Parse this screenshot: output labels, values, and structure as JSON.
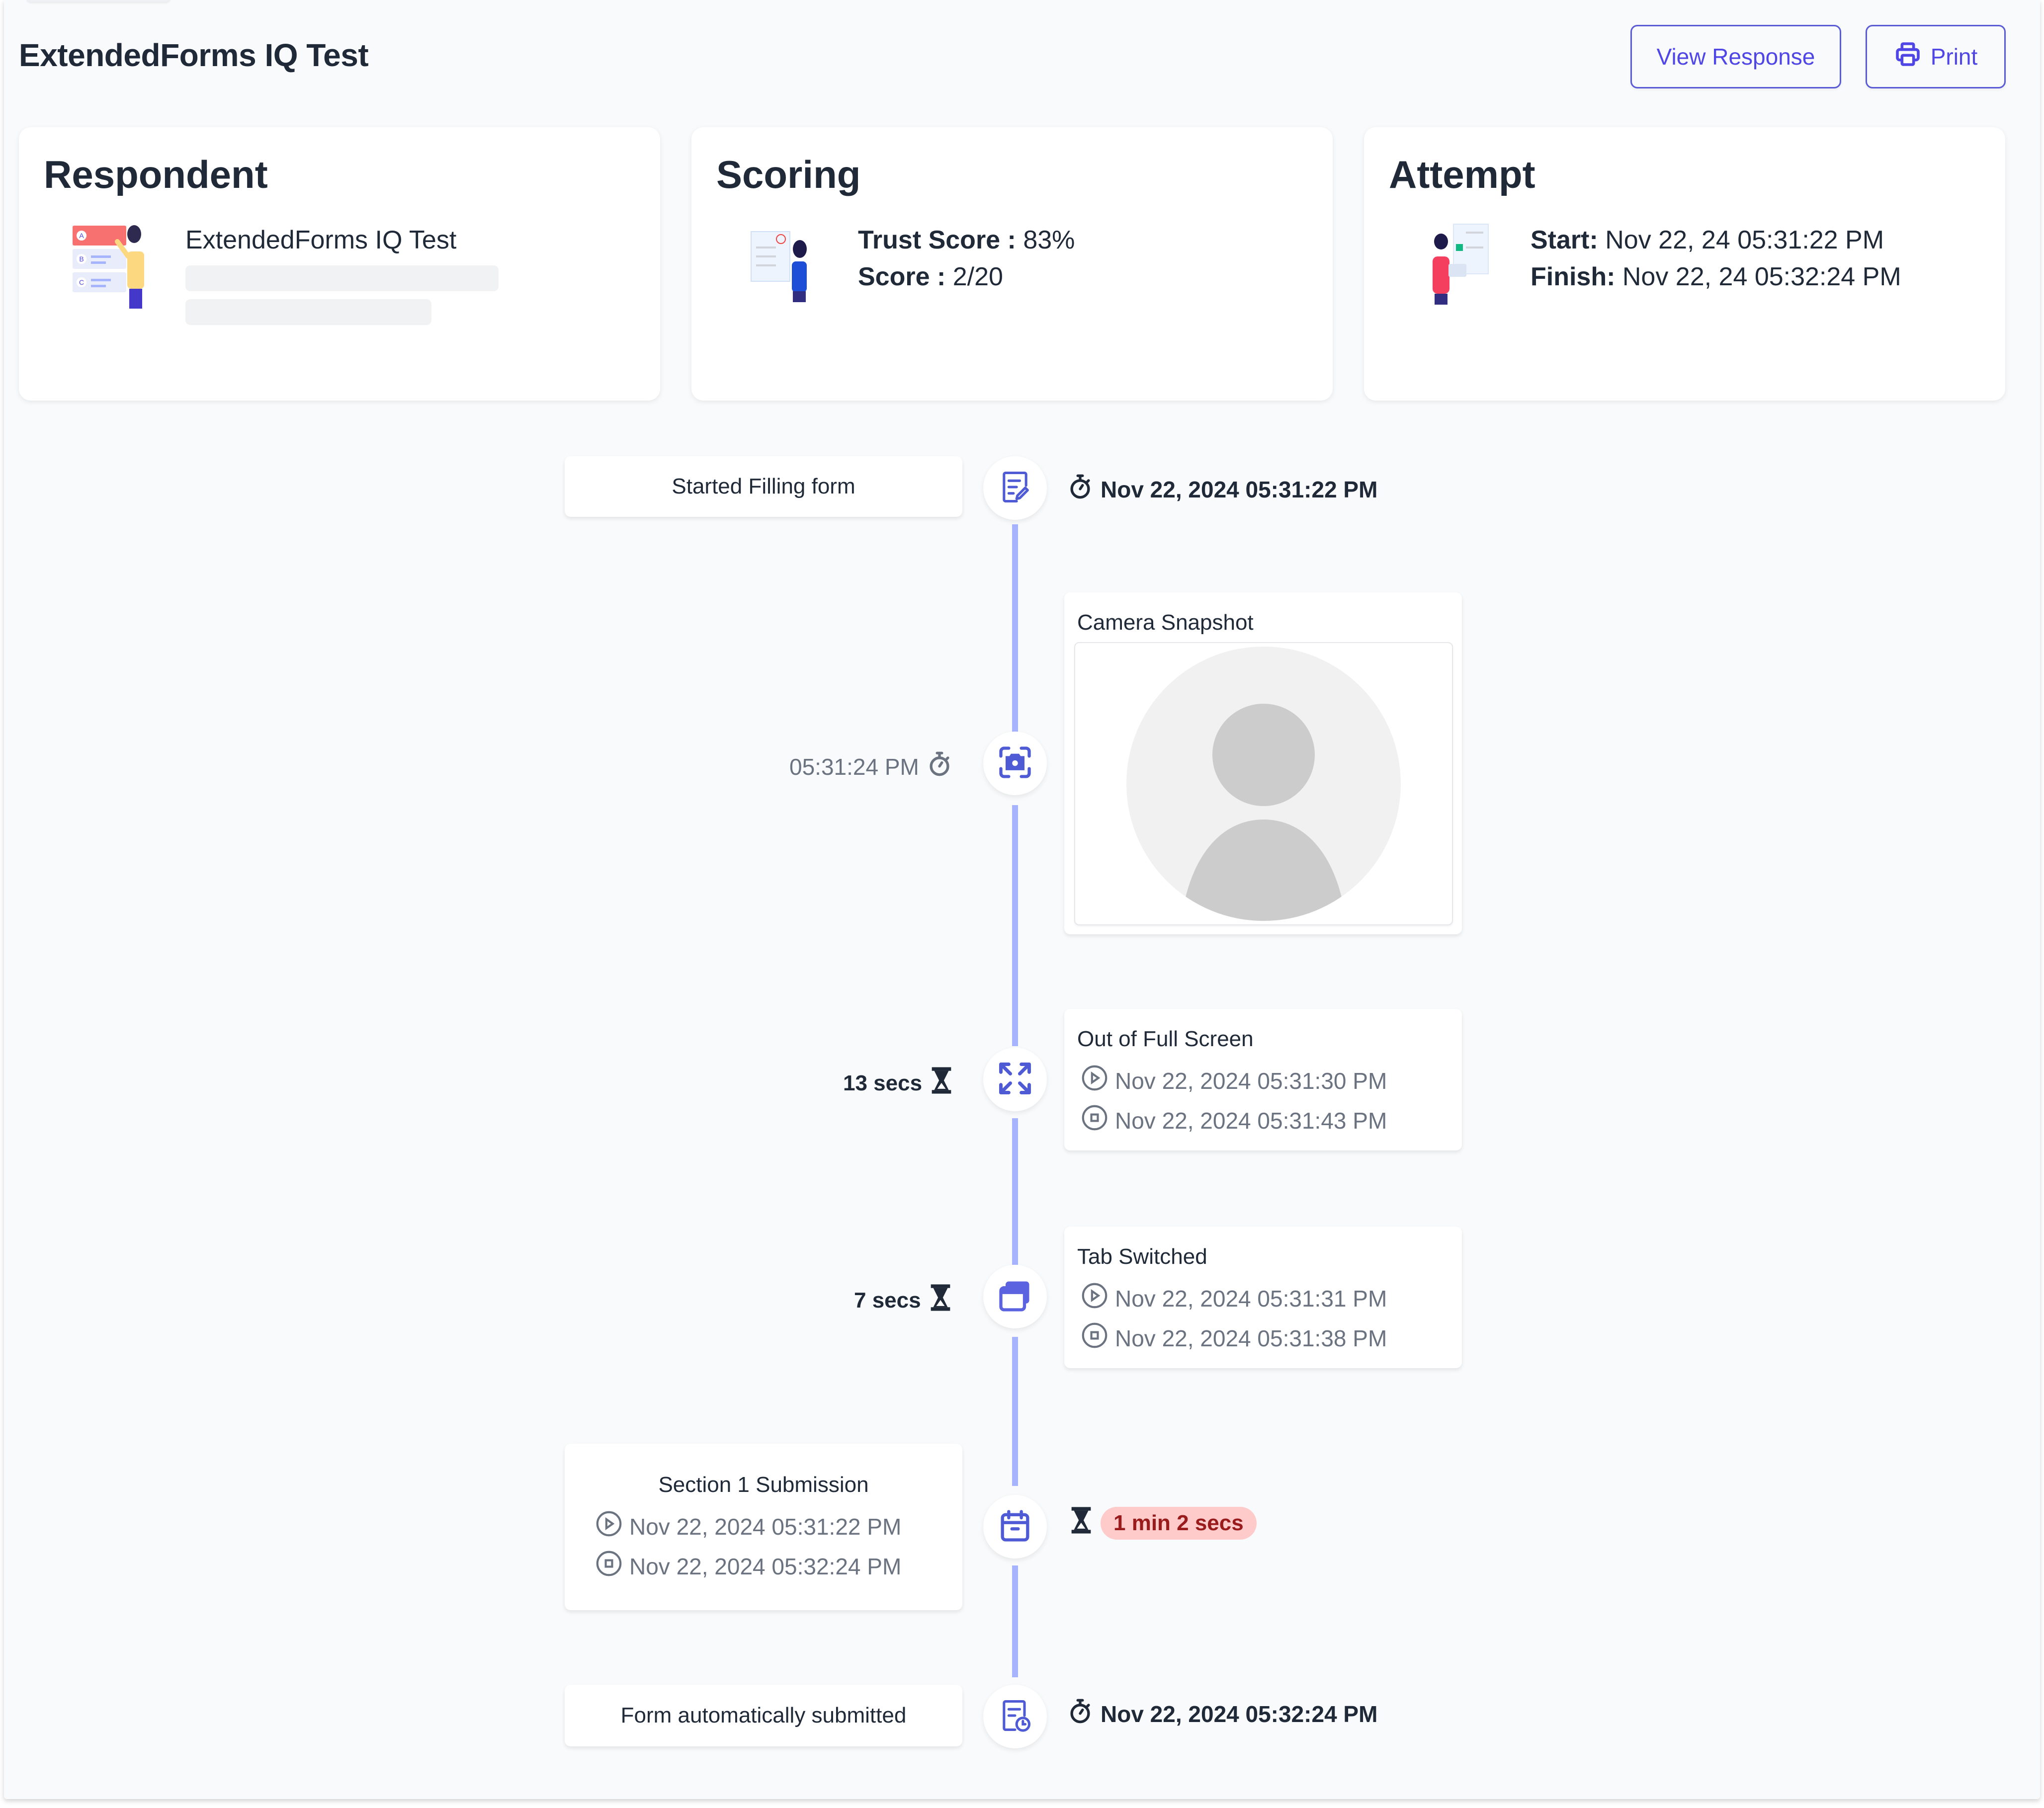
{
  "header": {
    "title": "ExtendedForms IQ Test",
    "view_response_label": "View Response",
    "print_label": "Print"
  },
  "colors": {
    "accent": "#4f46e5",
    "timeline": "#a5b4fc",
    "badge_bg": "#fecaca",
    "badge_text": "#991b1b"
  },
  "respondent": {
    "title": "Respondent",
    "name": "ExtendedForms IQ Test",
    "illustration_options": [
      "A",
      "B",
      "C"
    ]
  },
  "scoring": {
    "title": "Scoring",
    "trust_label": "Trust Score :",
    "trust_value": "83%",
    "score_label": "Score :",
    "score_value": "2/20"
  },
  "attempt": {
    "title": "Attempt",
    "start_label": "Start:",
    "start_value": "Nov 22, 24 05:31:22 PM",
    "finish_label": "Finish:",
    "finish_value": "Nov 22, 24 05:32:24 PM"
  },
  "timeline": {
    "started": {
      "label": "Started Filling form",
      "time": "Nov 22, 2024 05:31:22 PM",
      "icon": "form-edit-icon"
    },
    "camera": {
      "title": "Camera Snapshot",
      "time": "05:31:24 PM",
      "icon": "camera-icon"
    },
    "fullscreen": {
      "title": "Out of Full Screen",
      "duration": "13 secs",
      "start": "Nov 22, 2024 05:31:30 PM",
      "end": "Nov 22, 2024 05:31:43 PM",
      "icon": "exit-fullscreen-icon"
    },
    "tab_switch": {
      "title": "Tab Switched",
      "duration": "7 secs",
      "start": "Nov 22, 2024 05:31:31 PM",
      "end": "Nov 22, 2024 05:31:38 PM",
      "icon": "tab-switch-icon"
    },
    "section": {
      "title": "Section 1 Submission",
      "start": "Nov 22, 2024 05:31:22 PM",
      "end": "Nov 22, 2024 05:32:24 PM",
      "duration": "1 min 2 secs",
      "icon": "calendar-icon"
    },
    "submitted": {
      "label": "Form automatically submitted",
      "time": "Nov 22, 2024 05:32:24 PM",
      "icon": "form-clock-icon"
    }
  }
}
